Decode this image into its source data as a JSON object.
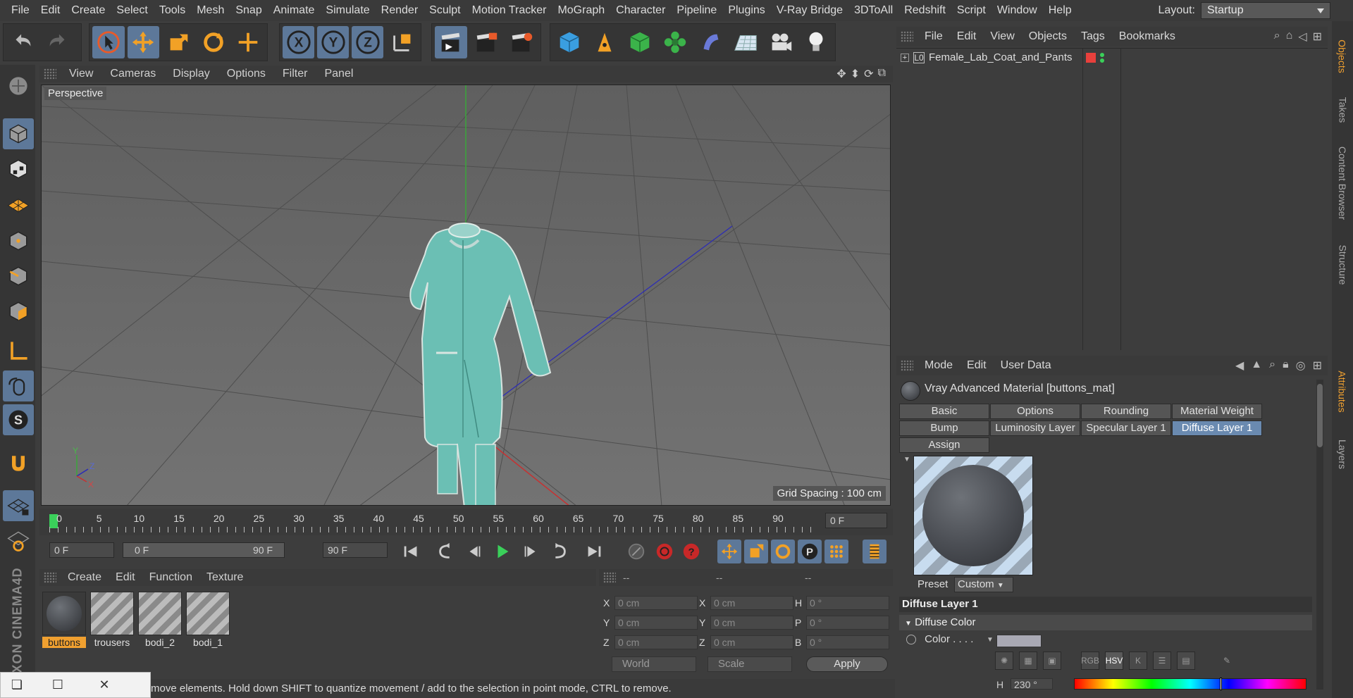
{
  "menubar": {
    "items": [
      "File",
      "Edit",
      "Create",
      "Select",
      "Tools",
      "Mesh",
      "Snap",
      "Animate",
      "Simulate",
      "Render",
      "Sculpt",
      "Motion Tracker",
      "MoGraph",
      "Character",
      "Pipeline",
      "Plugins",
      "V-Ray Bridge",
      "3DToAll",
      "Redshift",
      "Script",
      "Window",
      "Help"
    ],
    "layout_label": "Layout:",
    "layout_value": "Startup"
  },
  "viewport": {
    "menu": [
      "View",
      "Cameras",
      "Display",
      "Options",
      "Filter",
      "Panel"
    ],
    "label": "Perspective",
    "grid_spacing": "Grid Spacing : 100 cm",
    "axis_labels": {
      "x": "X",
      "y": "Y",
      "z": "Z"
    }
  },
  "timeline": {
    "ticks": [
      "0",
      "5",
      "10",
      "15",
      "20",
      "25",
      "30",
      "35",
      "40",
      "45",
      "50",
      "55",
      "60",
      "65",
      "70",
      "75",
      "80",
      "85",
      "90"
    ],
    "current_frame": "0 F"
  },
  "transport": {
    "start_field": "0 F",
    "range_start": "0 F",
    "range_end": "90 F",
    "end_field": "90 F"
  },
  "material_manager": {
    "menu": [
      "Create",
      "Edit",
      "Function",
      "Texture"
    ],
    "materials": [
      {
        "name": "buttons",
        "selected": true
      },
      {
        "name": "trousers",
        "selected": false
      },
      {
        "name": "bodi_2",
        "selected": false
      },
      {
        "name": "bodi_1",
        "selected": false
      }
    ]
  },
  "coordinates": {
    "headers": [
      "--",
      "--",
      "--"
    ],
    "rows": [
      {
        "l1": "X",
        "v1": "0 cm",
        "l2": "X",
        "v2": "0 cm",
        "l3": "H",
        "v3": "0 °"
      },
      {
        "l1": "Y",
        "v1": "0 cm",
        "l2": "Y",
        "v2": "0 cm",
        "l3": "P",
        "v3": "0 °"
      },
      {
        "l1": "Z",
        "v1": "0 cm",
        "l2": "Z",
        "v2": "0 cm",
        "l3": "B",
        "v3": "0 °"
      }
    ],
    "mode_dropdown": "World",
    "scale_dropdown": "Scale",
    "apply_label": "Apply"
  },
  "status": {
    "text": "move elements. Hold down SHIFT to quantize movement / add to the selection in point mode, CTRL to remove."
  },
  "object_manager": {
    "menu": [
      "File",
      "Edit",
      "View",
      "Objects",
      "Tags",
      "Bookmarks"
    ],
    "objects": [
      {
        "name": "Female_Lab_Coat_and_Pants",
        "tag_color": "#e8403c"
      }
    ]
  },
  "attribute_manager": {
    "menu": [
      "Mode",
      "Edit",
      "User Data"
    ],
    "title": "Vray Advanced Material [buttons_mat]",
    "tabs_row1": [
      "Basic",
      "Options",
      "Rounding",
      "Material Weight"
    ],
    "tabs_row2": [
      "Bump",
      "Luminosity Layer",
      "Specular Layer 1",
      "Diffuse Layer 1"
    ],
    "tabs_row3": [
      "Assign"
    ],
    "active_tab": "Diffuse Layer 1",
    "preset_label": "Preset",
    "preset_value": "Custom",
    "section": "Diffuse Layer 1",
    "subsection": "Diffuse Color",
    "color_label": "Color . . . .",
    "color_value": "#a9a9b4",
    "color_modes": [
      "RGB",
      "HSV",
      "K"
    ],
    "h_label": "H",
    "h_value": "230 °"
  },
  "side_tabs": [
    "Objects",
    "Takes",
    "Content Browser",
    "Structure",
    "Attributes",
    "Layers"
  ],
  "accent_color": "#f0a030",
  "selection_blue": "#5d7899"
}
